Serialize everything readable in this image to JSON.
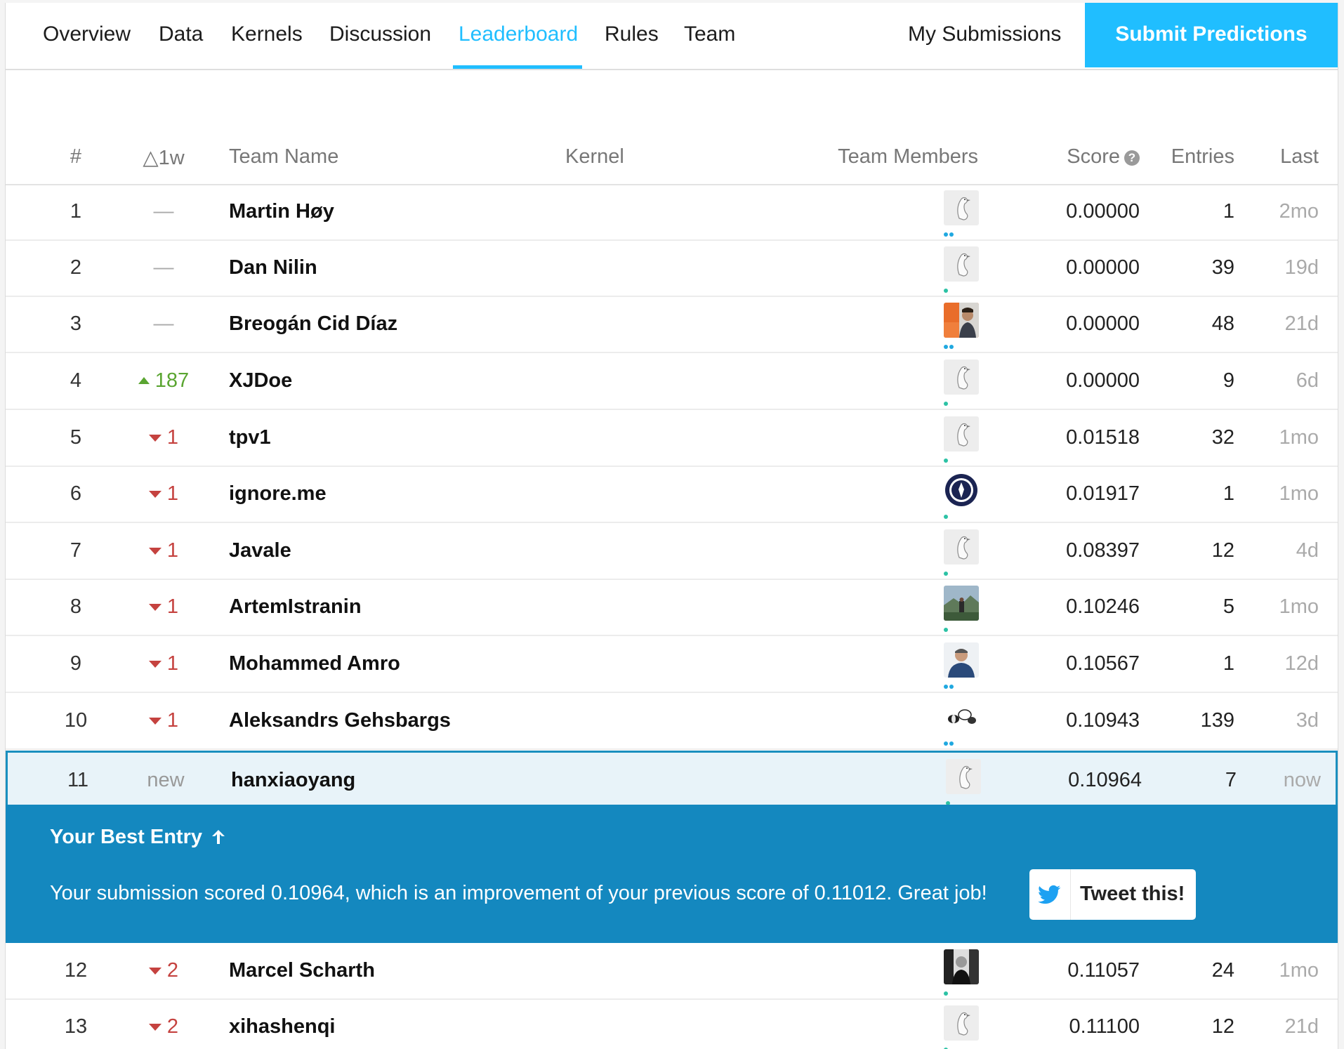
{
  "nav": {
    "tabs": [
      "Overview",
      "Data",
      "Kernels",
      "Discussion",
      "Leaderboard",
      "Rules",
      "Team"
    ],
    "active_tab": "Leaderboard",
    "my_submissions": "My Submissions",
    "submit": "Submit Predictions"
  },
  "table": {
    "headers": {
      "rank": "#",
      "change": "△1w",
      "team": "Team Name",
      "kernel": "Kernel",
      "members": "Team Members",
      "score": "Score",
      "entries": "Entries",
      "last": "Last"
    },
    "rows": [
      {
        "rank": "1",
        "change": "—",
        "change_type": "same",
        "team": "Martin Høy",
        "score": "0.00000",
        "entries": "1",
        "last": "2mo",
        "avatar": "goose",
        "dots": [
          "b",
          "b"
        ]
      },
      {
        "rank": "2",
        "change": "—",
        "change_type": "same",
        "team": "Dan Nilin",
        "score": "0.00000",
        "entries": "39",
        "last": "19d",
        "avatar": "goose",
        "dots": [
          "c"
        ]
      },
      {
        "rank": "3",
        "change": "—",
        "change_type": "same",
        "team": "Breogán Cid Díaz",
        "score": "0.00000",
        "entries": "48",
        "last": "21d",
        "avatar": "photo-man",
        "dots": [
          "b",
          "b"
        ]
      },
      {
        "rank": "4",
        "change": "187",
        "change_type": "up",
        "team": "XJDoe",
        "score": "0.00000",
        "entries": "9",
        "last": "6d",
        "avatar": "goose",
        "dots": [
          "c"
        ]
      },
      {
        "rank": "5",
        "change": "1",
        "change_type": "down",
        "team": "tpv1",
        "score": "0.01518",
        "entries": "32",
        "last": "1mo",
        "avatar": "goose",
        "dots": [
          "c"
        ]
      },
      {
        "rank": "6",
        "change": "1",
        "change_type": "down",
        "team": "ignore.me",
        "score": "0.01917",
        "entries": "1",
        "last": "1mo",
        "avatar": "seal",
        "dots": [
          "c"
        ]
      },
      {
        "rank": "7",
        "change": "1",
        "change_type": "down",
        "team": "Javale",
        "score": "0.08397",
        "entries": "12",
        "last": "4d",
        "avatar": "goose",
        "dots": [
          "c"
        ]
      },
      {
        "rank": "8",
        "change": "1",
        "change_type": "down",
        "team": "ArtemIstranin",
        "score": "0.10246",
        "entries": "5",
        "last": "1mo",
        "avatar": "photo-landscape",
        "dots": [
          "c"
        ]
      },
      {
        "rank": "9",
        "change": "1",
        "change_type": "down",
        "team": "Mohammed Amro",
        "score": "0.10567",
        "entries": "1",
        "last": "12d",
        "avatar": "photo-man2",
        "dots": [
          "b",
          "b"
        ]
      },
      {
        "rank": "10",
        "change": "1",
        "change_type": "down",
        "team": "Aleksandrs Gehsbargs",
        "score": "0.10943",
        "entries": "139",
        "last": "3d",
        "avatar": "bees",
        "dots": [
          "b",
          "b"
        ]
      },
      {
        "rank": "11",
        "change": "new",
        "change_type": "new",
        "team": "hanxiaoyang",
        "score": "0.10964",
        "entries": "7",
        "last": "now",
        "avatar": "goose",
        "dots": [
          "c"
        ],
        "me": true
      },
      {
        "rank": "12",
        "change": "2",
        "change_type": "down",
        "team": "Marcel Scharth",
        "score": "0.11057",
        "entries": "24",
        "last": "1mo",
        "avatar": "photo-bw",
        "dots": [
          "c"
        ]
      },
      {
        "rank": "13",
        "change": "2",
        "change_type": "down",
        "team": "xihashenqi",
        "score": "0.11100",
        "entries": "12",
        "last": "21d",
        "avatar": "goose",
        "dots": [
          "c"
        ]
      }
    ]
  },
  "best_entry": {
    "title": "Your Best Entry",
    "message": "Your submission scored 0.10964, which is an improvement of your previous score of 0.11012. Great job!",
    "tweet": "Tweet this!"
  },
  "colors": {
    "accent": "#20beff",
    "banner": "#1488bf",
    "up": "#5aa531",
    "down": "#c5423f"
  }
}
